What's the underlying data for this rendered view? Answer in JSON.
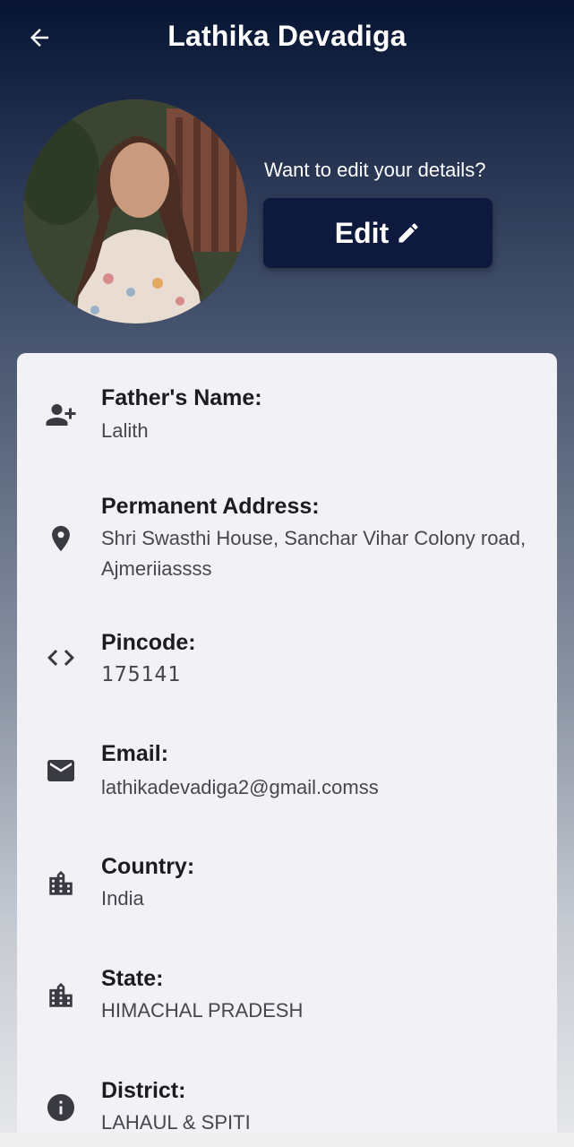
{
  "header": {
    "title": "Lathika Devadiga",
    "back_icon": "arrow-left-icon"
  },
  "profile": {
    "edit_prompt": "Want to edit your details?",
    "edit_label": "Edit",
    "edit_icon": "pencil-icon"
  },
  "colors": {
    "header_dark": "#071432",
    "button_bg": "#0d1a3d",
    "card_bg": "#f1f1f6"
  },
  "details": [
    {
      "label": "Father's Name:",
      "value": "Lalith",
      "icon": "person-add-icon"
    },
    {
      "label": "Permanent Address:",
      "value": "Shri Swasthi House, Sanchar Vihar Colony road, Ajmeriiassss",
      "icon": "location-pin-icon"
    },
    {
      "label": "Pincode:",
      "value": "175141",
      "icon": "code-icon"
    },
    {
      "label": "Email:",
      "value": "lathikadevadiga2@gmail.comss",
      "icon": "mail-icon"
    },
    {
      "label": "Country:",
      "value": "India",
      "icon": "city-icon"
    },
    {
      "label": "State:",
      "value": "HIMACHAL PRADESH",
      "icon": "city-icon"
    },
    {
      "label": "District:",
      "value": "LAHAUL & SPITI",
      "icon": "info-icon"
    }
  ]
}
